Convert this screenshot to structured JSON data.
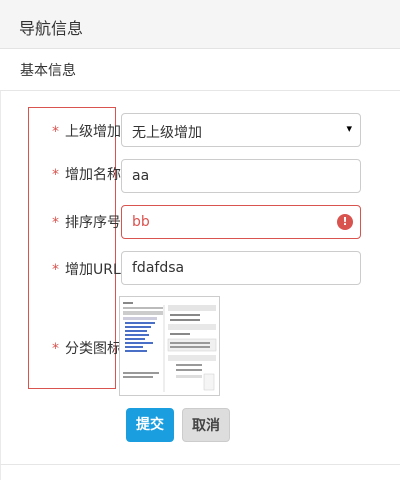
{
  "header": {
    "title": "导航信息"
  },
  "section": {
    "title": "基本信息"
  },
  "form": {
    "required_mark": "*",
    "parent_label": "上级增加",
    "parent_value": "无上级增加",
    "name_label": "增加名称",
    "name_value": "aa",
    "order_label": "排序序号",
    "order_value": "bb",
    "order_error_icon": "!",
    "url_label": "增加URL",
    "url_value": "fdafdsa",
    "icon_label": "分类图标",
    "select_caret": "▾"
  },
  "buttons": {
    "submit": "提交",
    "cancel": "取消"
  },
  "colors": {
    "error": "#d9534f",
    "primary": "#1a9ee0",
    "header_bg": "#f5f5f5"
  }
}
